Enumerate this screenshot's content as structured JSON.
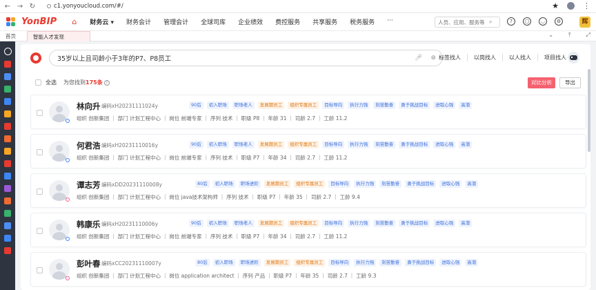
{
  "browser": {
    "url": "c1.yonyoucloud.com/#/"
  },
  "header": {
    "brand": "YonBIP",
    "menu": [
      {
        "label": "财务云 ▾",
        "active": true
      },
      {
        "label": "财务会计"
      },
      {
        "label": "管理会计"
      },
      {
        "label": "全球司库"
      },
      {
        "label": "企业绩效"
      },
      {
        "label": "费控服务"
      },
      {
        "label": "共享服务"
      },
      {
        "label": "税务服务"
      },
      {
        "label": "···"
      }
    ],
    "search_placeholder": "人员、应用、服务等",
    "user_initial": "辉"
  },
  "tabs": {
    "home": "首页",
    "active": "智能人才发现"
  },
  "search": {
    "query": "35岁以上且司龄小于3年的P7、P8员工",
    "modes": [
      "标签找人",
      "以岗找人",
      "以人找人",
      "项目找人"
    ]
  },
  "result_bar": {
    "select_all": "全选",
    "found_prefix": "为您找到",
    "found_count": "175条",
    "compare_button": "对比分析",
    "export_button": "导出"
  },
  "candidates": [
    {
      "name": "林向升",
      "code": "编码xH20231111024y",
      "gender": "m",
      "tags": [
        [
          "90后",
          "blue"
        ],
        [
          "初入职场",
          "blue"
        ],
        [
          "职场老人",
          "blue"
        ],
        [
          "发展期员工",
          "orange"
        ],
        [
          "组织专属员工",
          "orange"
        ],
        [
          "目标导向",
          "blue"
        ],
        [
          "执行力强",
          "blue"
        ],
        [
          "刻苦勤奋",
          "blue"
        ],
        [
          "勇于挑战目标",
          "blue"
        ],
        [
          "进取心强",
          "blue"
        ],
        [
          "高潜",
          "blue"
        ]
      ],
      "info": "组织 创新集团 ｜ 部门 计划工程中心 ｜ 岗位 前端专家 ｜ 序列 技术 ｜ 职级 P8 ｜ 年龄 31 ｜ 司龄 2.7 ｜ 工龄 11.2"
    },
    {
      "name": "何君浩",
      "code": "编码xH20231110016y",
      "gender": "m",
      "tags": [
        [
          "90后",
          "blue"
        ],
        [
          "初入职场",
          "blue"
        ],
        [
          "职场老人",
          "blue"
        ],
        [
          "发展期员工",
          "orange"
        ],
        [
          "组织专属员工",
          "orange"
        ],
        [
          "目标导向",
          "blue"
        ],
        [
          "执行力强",
          "blue"
        ],
        [
          "刻苦勤奋",
          "blue"
        ],
        [
          "勇于挑战目标",
          "blue"
        ],
        [
          "进取心强",
          "blue"
        ],
        [
          "高潜",
          "blue"
        ]
      ],
      "info": "组织 创新集团 ｜ 部门 计划工程中心 ｜ 岗位 前端专家 ｜ 序列 技术 ｜ 职级 P7 ｜ 年龄 34 ｜ 司龄 2.7 ｜ 工龄 11.2"
    },
    {
      "name": "谭志芳",
      "code": "编码xDD20231110008y",
      "gender": "f",
      "tags": [
        [
          "80后",
          "blue"
        ],
        [
          "初入职场",
          "blue"
        ],
        [
          "职场进阶",
          "blue"
        ],
        [
          "发展期员工",
          "orange"
        ],
        [
          "组织专属员工",
          "orange"
        ],
        [
          "目标导向",
          "blue"
        ],
        [
          "执行力强",
          "blue"
        ],
        [
          "刻苦勤奋",
          "blue"
        ],
        [
          "勇于挑战目标",
          "blue"
        ],
        [
          "进取心强",
          "blue"
        ],
        [
          "高潜",
          "blue"
        ]
      ],
      "info": "组织 创新集团 ｜ 部门 计划工程中心 ｜ 岗位 java技术架构师 ｜ 序列 技术 ｜ 职级 P7 ｜ 年龄 35 ｜ 司龄 2.7 ｜ 工龄 9.4"
    },
    {
      "name": "韩康乐",
      "code": "编码xH20231110006y",
      "gender": "m",
      "tags": [
        [
          "90后",
          "blue"
        ],
        [
          "初入职场",
          "blue"
        ],
        [
          "职场老人",
          "blue"
        ],
        [
          "发展期员工",
          "orange"
        ],
        [
          "组织专属员工",
          "orange"
        ],
        [
          "目标导向",
          "blue"
        ],
        [
          "执行力强",
          "blue"
        ],
        [
          "刻苦勤奋",
          "blue"
        ],
        [
          "勇于挑战目标",
          "blue"
        ],
        [
          "进取心强",
          "blue"
        ],
        [
          "高潜",
          "blue"
        ]
      ],
      "info": "组织 创新集团 ｜ 部门 计划工程中心 ｜ 岗位 前端专家 ｜ 序列 技术 ｜ 职级 P7 ｜ 年龄 34 ｜ 司龄 2.7 ｜ 工龄 11.2"
    },
    {
      "name": "彭叶春",
      "code": "编码xCC20231110007y",
      "gender": "f",
      "tags": [
        [
          "80后",
          "blue"
        ],
        [
          "初入职场",
          "blue"
        ],
        [
          "职场进阶",
          "blue"
        ],
        [
          "发展期员工",
          "orange"
        ],
        [
          "组织专属员工",
          "orange"
        ],
        [
          "目标导向",
          "blue"
        ],
        [
          "执行力强",
          "blue"
        ],
        [
          "刻苦勤奋",
          "blue"
        ],
        [
          "勇于挑战目标",
          "blue"
        ],
        [
          "进取心强",
          "blue"
        ],
        [
          "高潜",
          "blue"
        ]
      ],
      "info": "组织 创新集团 ｜ 部门 计划工程中心 ｜ 岗位 application architect ｜ 序列 产品 ｜ 职级 P7 ｜ 年龄 35 ｜ 司龄 2.7 ｜ 工龄 9.3"
    }
  ],
  "colors": {
    "brand_red": "#e83a30",
    "tag_blue": "#3d6fd8",
    "tag_orange": "#e07a18",
    "rail": "#2f3441"
  }
}
